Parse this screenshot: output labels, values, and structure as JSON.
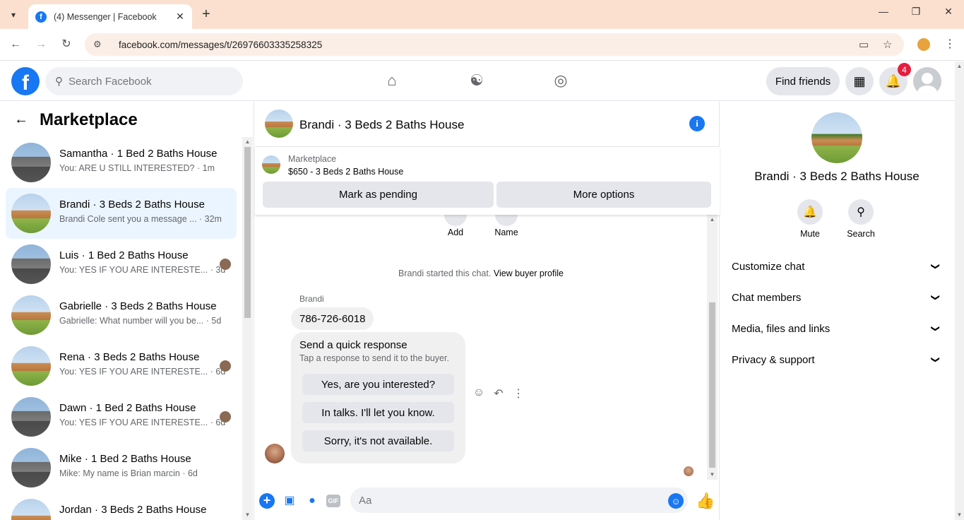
{
  "browser": {
    "tab_title": "(4) Messenger | Facebook",
    "url": "facebook.com/messages/t/26976603335258325"
  },
  "header": {
    "search_placeholder": "Search Facebook",
    "find_friends": "Find friends",
    "notification_count": "4"
  },
  "sidebar": {
    "title": "Marketplace",
    "conversations": [
      {
        "name": "Samantha · 1 Bed 2 Baths House",
        "snippet": "You: ARE U STILL INTERESTED? · 1m",
        "thumb": "a"
      },
      {
        "name": "Brandi · 3 Beds 2 Baths House",
        "snippet": "Brandi Cole sent you a message ... · 32m",
        "thumb": "b",
        "active": true
      },
      {
        "name": "Luis · 1 Bed 2 Baths House",
        "snippet": "You: YES IF YOU ARE INTERESTE... · 3d",
        "thumb": "a",
        "seen": true
      },
      {
        "name": "Gabrielle · 3 Beds 2 Baths House",
        "snippet": "Gabrielle: What number will you be... · 5d",
        "thumb": "b"
      },
      {
        "name": "Rena · 3 Beds 2 Baths House",
        "snippet": "You: YES IF YOU ARE INTERESTE... · 6d",
        "thumb": "b",
        "seen": true
      },
      {
        "name": "Dawn · 1 Bed 2 Baths House",
        "snippet": "You: YES IF YOU ARE INTERESTE... · 6d",
        "thumb": "a",
        "seen": true
      },
      {
        "name": "Mike · 1 Bed 2 Baths House",
        "snippet": "Mike: My name is Brian marcin · 6d",
        "thumb": "a"
      },
      {
        "name": "Jordan · 3 Beds 2 Baths House",
        "snippet": "",
        "thumb": "b"
      }
    ]
  },
  "chat": {
    "title": "Brandi · 3 Beds 2 Baths House",
    "marketplace_label": "Marketplace",
    "listing": "$650 - 3 Beds 2 Baths House",
    "mark_pending": "Mark as pending",
    "more_options": "More options",
    "peek_add": "Add",
    "peek_name": "Name",
    "system_msg": "Brandi started this chat.",
    "view_profile": "View buyer profile",
    "sender": "Brandi",
    "message": "786-726-6018",
    "quick_title": "Send a quick response",
    "quick_sub": "Tap a response to send it to the buyer.",
    "quick_options": [
      "Yes, are you interested?",
      "In talks. I'll let you know.",
      "Sorry, it's not available."
    ],
    "composer_placeholder": "Aa"
  },
  "details": {
    "name": "Brandi · 3 Beds 2 Baths House",
    "mute": "Mute",
    "search": "Search",
    "sections": [
      "Customize chat",
      "Chat members",
      "Media, files and links",
      "Privacy & support"
    ]
  }
}
